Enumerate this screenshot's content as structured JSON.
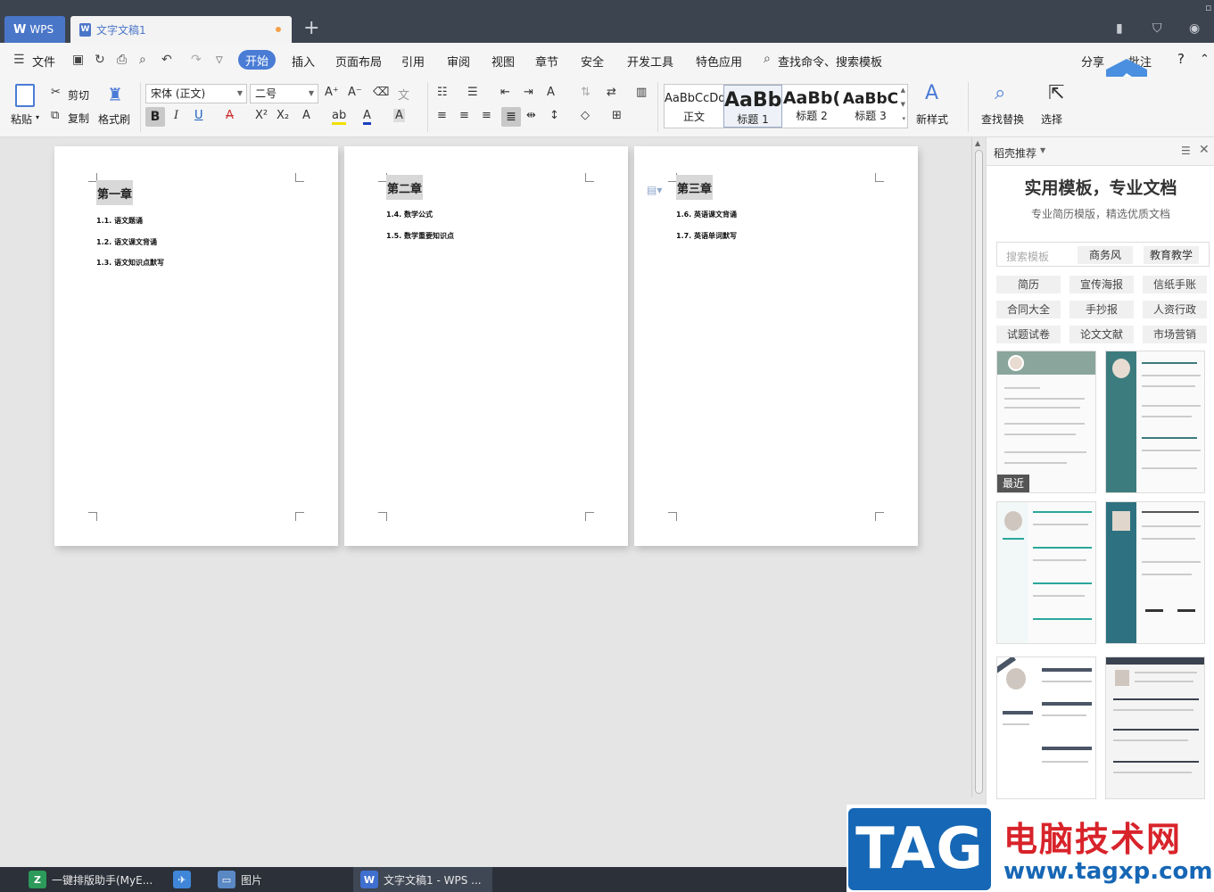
{
  "titlebar": {
    "wps_tab": "WPS",
    "doc_tab": "文字文稿1",
    "new_tab": "+"
  },
  "menubar": {
    "file": "文件",
    "items": [
      "开始",
      "插入",
      "页面布局",
      "引用",
      "审阅",
      "视图",
      "章节",
      "安全",
      "开发工具",
      "特色应用"
    ],
    "search": "查找命令、搜索模板",
    "share": "分享",
    "comment": "批注",
    "help": "?"
  },
  "ribbon": {
    "paste": "粘贴",
    "cut": "剪切",
    "copy": "复制",
    "format_painter": "格式刷",
    "font_name": "宋体 (正文)",
    "font_size": "二号",
    "styles": [
      {
        "sample": "AaBbCcDd",
        "name": "正文"
      },
      {
        "sample": "AaBb",
        "name": "标题 1"
      },
      {
        "sample": "AaBb(",
        "name": "标题 2"
      },
      {
        "sample": "AaBbC",
        "name": "标题 3"
      }
    ],
    "new_style": "新样式",
    "find_replace": "查找替换",
    "select": "选择"
  },
  "pages": [
    {
      "heading": "第一章",
      "lines": [
        "1.1. 语文题诵",
        "1.2. 语文课文背诵",
        "1.3. 语文知识点默写"
      ]
    },
    {
      "heading": "第二章",
      "lines": [
        "1.4. 数学公式",
        "1.5. 数学重要知识点"
      ]
    },
    {
      "heading": "第三章",
      "lines": [
        "1.6. 英语课文背诵",
        "1.7. 英语单词默写"
      ]
    }
  ],
  "sidepanel": {
    "title": "稻壳推荐",
    "headline": "实用模板，专业文档",
    "subtitle": "专业简历模版，精选优质文档",
    "search_placeholder": "搜索模板",
    "quick_tags": [
      "商务风",
      "教育教学"
    ],
    "categories": [
      "简历",
      "宣传海报",
      "信纸手账",
      "合同大全",
      "手抄报",
      "人资行政",
      "试题试卷",
      "论文文献",
      "市场营销"
    ],
    "recent_label": "最近"
  },
  "taskbar": {
    "items": [
      "一键排版助手(MyE...",
      "",
      "图片",
      "文字文稿1 - WPS ..."
    ]
  },
  "watermark": {
    "tag": "TAG",
    "cn": "电脑技术网",
    "url": "www.tagxp.com"
  },
  "colors": {
    "accent": "#4a7cd6",
    "titlebar": "#3c4450",
    "taskbar": "#2b3039",
    "watermark_blue": "#1667b5",
    "watermark_red": "#d8232a"
  }
}
